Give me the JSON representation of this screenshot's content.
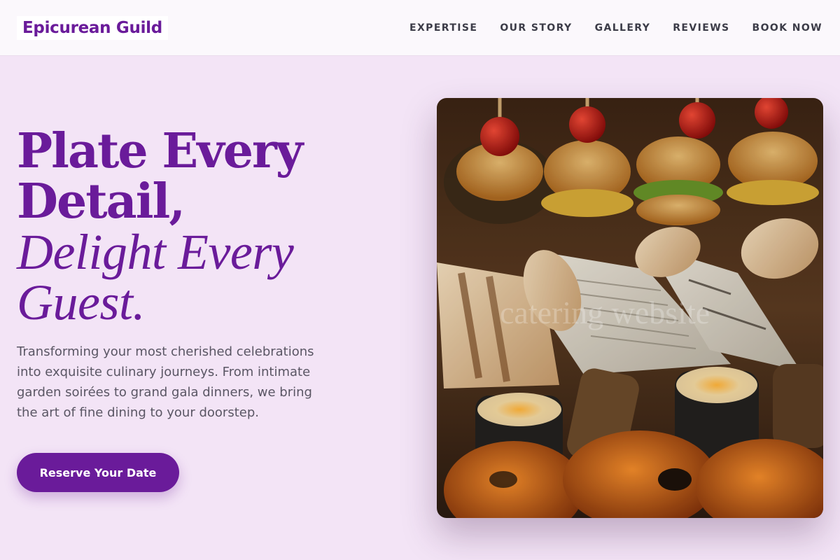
{
  "header": {
    "logo": "Epicurean Guild",
    "nav": [
      {
        "label": "EXPERTISE"
      },
      {
        "label": "OUR STORY"
      },
      {
        "label": "GALLERY"
      },
      {
        "label": "REVIEWS"
      },
      {
        "label": "BOOK NOW"
      }
    ]
  },
  "hero": {
    "headline_line1": "Plate Every",
    "headline_line2": "Detail,",
    "headline_line3": "Delight Every",
    "headline_line4": "Guest.",
    "intro": "Transforming your most cherished celebrations into exquisite culinary journeys. From intimate garden soirées to grand gala dinners, we bring the art of fine dining to your doorstep.",
    "cta_label": "Reserve Your Date",
    "image_watermark": "catering website"
  },
  "colors": {
    "brand": "#6a1b9a",
    "background": "#f3e4f6",
    "header_bg": "#fbf8fc",
    "body_text": "#5a5664"
  }
}
